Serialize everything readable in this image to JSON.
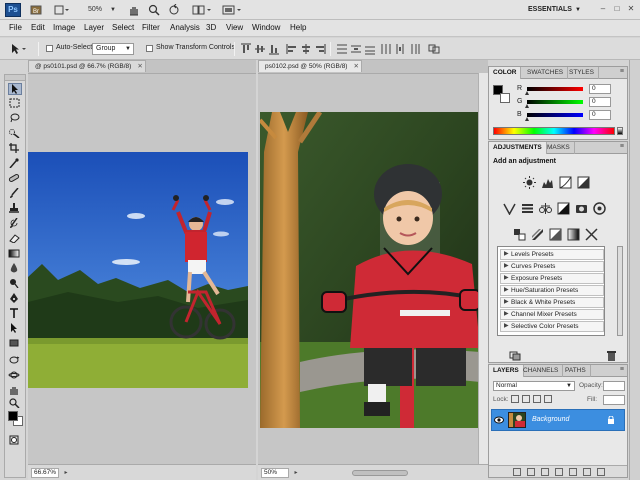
{
  "app": {
    "logo": "Ps",
    "zoom": "50%",
    "workspace": "ESSENTIALS"
  },
  "menu": [
    "File",
    "Edit",
    "Image",
    "Layer",
    "Select",
    "Filter",
    "Analysis",
    "3D",
    "View",
    "Window",
    "Help"
  ],
  "options": {
    "auto_select_label": "Auto-Select:",
    "auto_select_value": "Group",
    "show_transform_label": "Show Transform Controls"
  },
  "documents": [
    {
      "tab_title": "@ ps0101.psd @ 66.7% (RGB/8)",
      "zoom": "66.67%"
    },
    {
      "tab_title": "ps0102.psd @ 50% (RGB/8)",
      "zoom": "50%"
    }
  ],
  "color_panel": {
    "tabs": [
      "COLOR",
      "SWATCHES",
      "STYLES"
    ],
    "channels": [
      {
        "label": "R",
        "value": "0"
      },
      {
        "label": "G",
        "value": "0"
      },
      {
        "label": "B",
        "value": "0"
      }
    ]
  },
  "adjustments_panel": {
    "tabs": [
      "ADJUSTMENTS",
      "MASKS"
    ],
    "title": "Add an adjustment",
    "presets": [
      "Levels Presets",
      "Curves Presets",
      "Exposure Presets",
      "Hue/Saturation Presets",
      "Black & White Presets",
      "Channel Mixer Presets",
      "Selective Color Presets"
    ]
  },
  "layers_panel": {
    "tabs": [
      "LAYERS",
      "CHANNELS",
      "PATHS"
    ],
    "blend_mode": "Normal",
    "opacity_label": "Opacity:",
    "fill_label": "Fill:",
    "lock_label": "Lock:",
    "layer_name": "Background"
  },
  "colors": {
    "accent": "#3c8ee0",
    "logo_bg": "#1d4f91"
  }
}
